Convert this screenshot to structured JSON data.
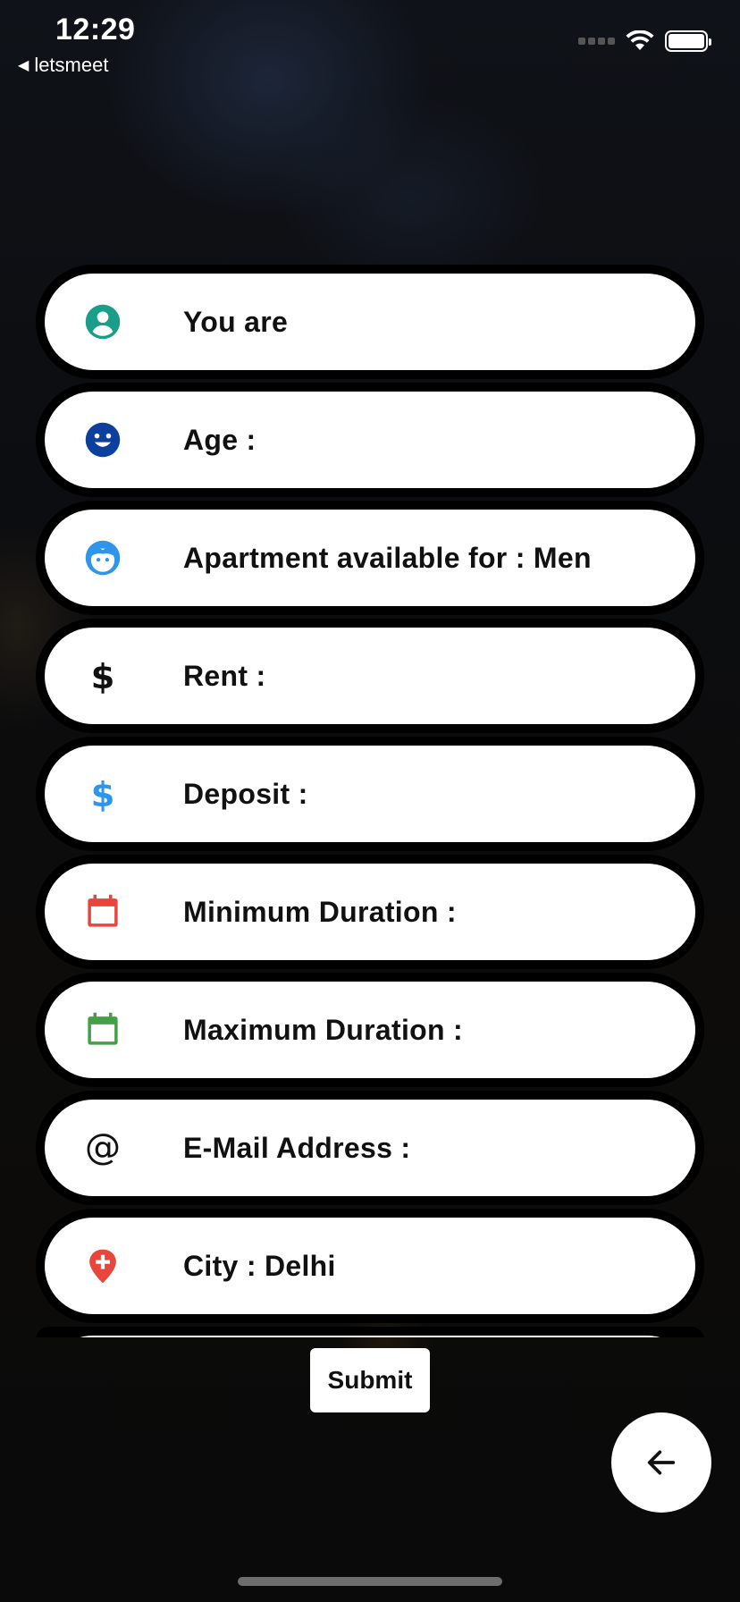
{
  "status_bar": {
    "time": "12:29",
    "back_app_label": "letsmeet",
    "back_arrow": "◀"
  },
  "form": {
    "fields": [
      {
        "label": "You are",
        "icon": "account-circle-icon",
        "icon_color": "#1a9e8a"
      },
      {
        "label": "Age :",
        "icon": "smiley-face-icon",
        "icon_color": "#0d3f9e"
      },
      {
        "label": "Apartment available for : Men",
        "icon": "child-face-icon",
        "icon_color": "#2f95ea"
      },
      {
        "label": "Rent :",
        "icon": "dollar-icon",
        "icon_color": "#111111"
      },
      {
        "label": "Deposit :",
        "icon": "dollar-icon",
        "icon_color": "#2f95ea"
      },
      {
        "label": "Minimum Duration :",
        "icon": "calendar-icon",
        "icon_color": "#e8453c"
      },
      {
        "label": "Maximum Duration :",
        "icon": "calendar-icon",
        "icon_color": "#43a047"
      },
      {
        "label": "E-Mail Address :",
        "icon": "at-sign-icon",
        "icon_color": "#111111"
      },
      {
        "label": "City : Delhi",
        "icon": "location-pin-icon",
        "icon_color": "#e8453c"
      }
    ]
  },
  "submit_label": "Submit",
  "fab_icon": "arrow-left-icon"
}
